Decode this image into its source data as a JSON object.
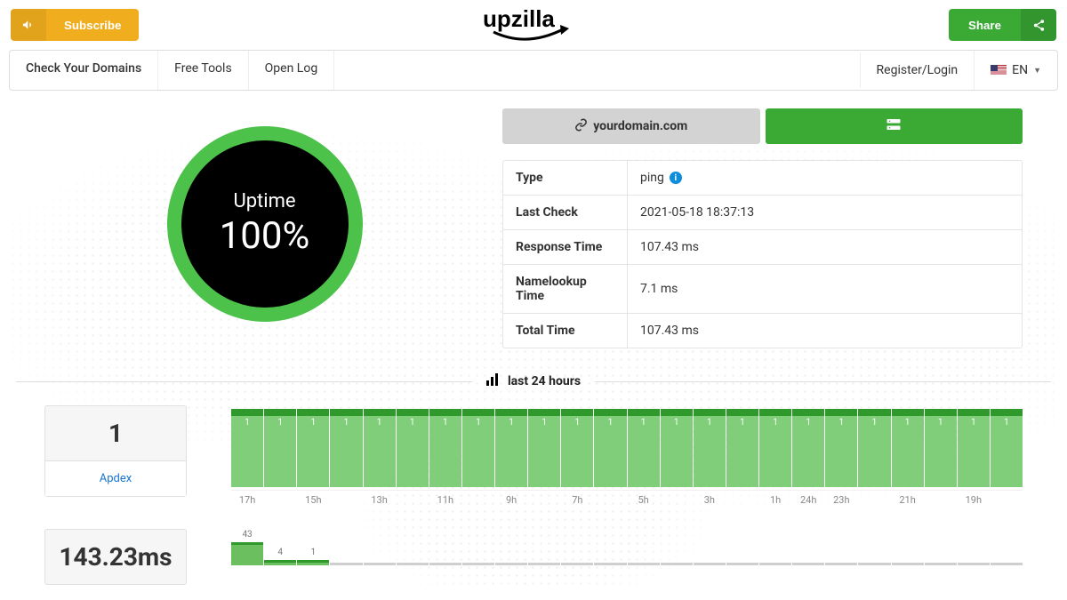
{
  "header": {
    "subscribe": "Subscribe",
    "share": "Share",
    "logo_text": "upzilla"
  },
  "nav": {
    "items": [
      "Check Your Domains",
      "Free Tools",
      "Open Log"
    ],
    "register_login": "Register/Login",
    "lang": "EN"
  },
  "gauge": {
    "label": "Uptime",
    "value": "100%"
  },
  "tabs": {
    "domain": "yourdomain.com"
  },
  "info": {
    "rows": [
      {
        "label": "Type",
        "value": "ping",
        "info": true
      },
      {
        "label": "Last Check",
        "value": "2021-05-18 18:37:13"
      },
      {
        "label": "Response Time",
        "value": "107.43 ms"
      },
      {
        "label": "Namelookup Time",
        "value": "7.1 ms"
      },
      {
        "label": "Total Time",
        "value": "107.43 ms"
      }
    ]
  },
  "section_title": "last 24 hours",
  "cards": {
    "apdex_value": "1",
    "apdex_label": "Apdex",
    "latency_value": "143.23ms"
  },
  "chart_data": {
    "type": "bar",
    "title": "Apdex last 24 hours",
    "categories": [
      "17h",
      "",
      "15h",
      "",
      "13h",
      "",
      "11h",
      "",
      "9h",
      "",
      "7h",
      "",
      "5h",
      "",
      "3h",
      "",
      "1h",
      "24h",
      "23h",
      "",
      "21h",
      "",
      "19h",
      ""
    ],
    "values": [
      1,
      1,
      1,
      1,
      1,
      1,
      1,
      1,
      1,
      1,
      1,
      1,
      1,
      1,
      1,
      1,
      1,
      1,
      1,
      1,
      1,
      1,
      1,
      1
    ],
    "ylim": [
      0,
      1
    ]
  },
  "chart_data2": {
    "type": "bar",
    "title": "Latency values (partial)",
    "categories_count": 24,
    "labeled_values": [
      {
        "i": 0,
        "v": 43
      },
      {
        "i": 1,
        "v": 4
      },
      {
        "i": 2,
        "v": 1
      }
    ]
  }
}
